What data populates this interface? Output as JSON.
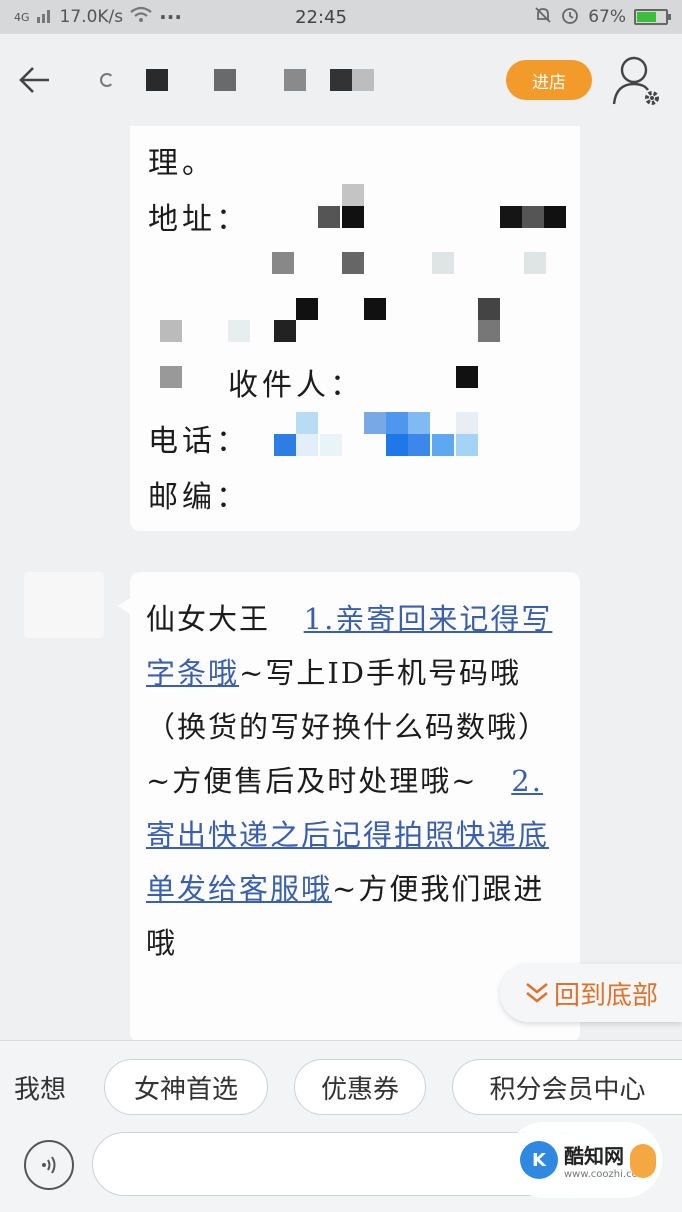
{
  "status_bar": {
    "network": "4G",
    "speed": "17.0K/s",
    "more": "···",
    "time": "22:45",
    "battery": "67%",
    "battery_level": 0.67
  },
  "header": {
    "enter_store_label": "进店"
  },
  "message1": {
    "line1": "理。",
    "address_label": "地址：",
    "recipient_label": "收件人：",
    "phone_label": "电话：",
    "postcode_label": "邮编："
  },
  "message2": {
    "greeting": "仙女大王",
    "link1": "1.亲寄回来记得写字条哦",
    "text1": "~写上ID手机号码哦（换货的写好换什么码数哦）~方便售后及时处理哦~",
    "link2": "2.寄出快递之后记得拍照快递底单发给客服哦",
    "text2": "~方便我们跟进哦"
  },
  "scroll_to_bottom_label": "回到底部",
  "suggestions": {
    "label": "我想",
    "chips": [
      "女神首选",
      "优惠券",
      "积分会员中心"
    ]
  },
  "watermark": {
    "name": "酷知网",
    "url": "www.coozhi.com"
  }
}
